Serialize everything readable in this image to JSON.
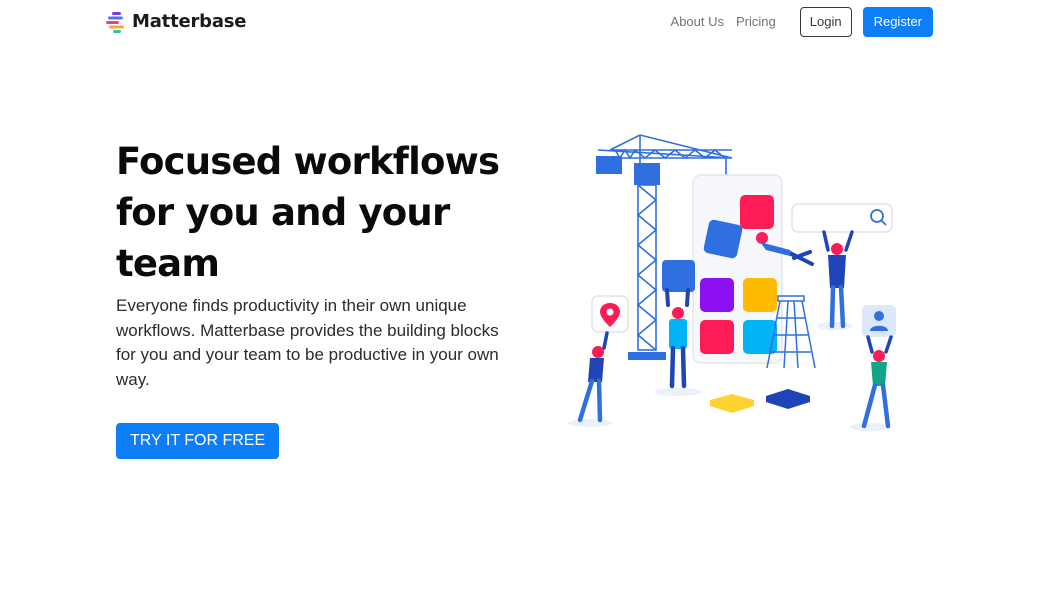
{
  "brand": {
    "name": "Matterbase",
    "logo_icon": "stacked-bars-logo-icon"
  },
  "nav": {
    "about_label": "About Us",
    "pricing_label": "Pricing",
    "login_label": "Login",
    "register_label": "Register"
  },
  "hero": {
    "title_line1": "Focused workflows",
    "title_line2": "for you and your",
    "title_line3": "team",
    "lead": "Everyone finds productivity in their own unique workflows. Matterbase provides the building blocks for you and your team to be productive in your own way.",
    "cta_label": "TRY IT FOR FREE"
  },
  "colors": {
    "primary": "#0d7ef6",
    "heading": "#0a0a0a",
    "nav_link": "#6c757d",
    "illus_blue": "#2f6fe0",
    "illus_red": "#fc1d57",
    "illus_purple": "#8c10f0",
    "illus_yellow": "#ffbb00",
    "illus_cyan": "#00b4f5"
  },
  "illustration_icons": [
    "construction-crane-icon",
    "search-icon",
    "location-pin-icon",
    "user-profile-icon",
    "ladder-icon"
  ]
}
